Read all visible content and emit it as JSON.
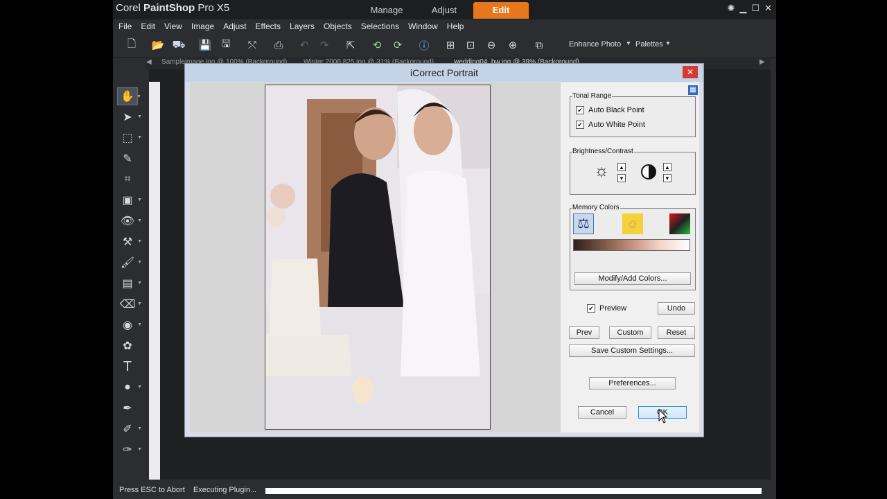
{
  "app": {
    "brand_light": "Corel ",
    "brand_bold": "PaintShop",
    "brand_suffix": " Pro X5",
    "tabs": [
      {
        "label": "Manage",
        "active": false
      },
      {
        "label": "Adjust",
        "active": false
      },
      {
        "label": "Edit",
        "active": true
      }
    ]
  },
  "menu": [
    "File",
    "Edit",
    "View",
    "Image",
    "Adjust",
    "Effects",
    "Layers",
    "Objects",
    "Selections",
    "Window",
    "Help"
  ],
  "toolbar": {
    "enhance_photo": "Enhance Photo",
    "palettes": "Palettes"
  },
  "doc_tabs": [
    "Sampleimage.jpg @ 100% (Background)",
    "Winter 2006 825.jpg @ 31% (Background)",
    "wedding04_bw.jpg @ 39% (Background)"
  ],
  "status": {
    "left": "Press ESC to Abort",
    "right": "Executing Plugin..."
  },
  "dialog": {
    "title": "iCorrect Portrait",
    "close_glyph": "✕",
    "tonal_range": {
      "label": "Tonal Range",
      "auto_black": "Auto Black Point",
      "auto_white": "Auto White Point"
    },
    "brightness_contrast": {
      "label": "Brightness/Contrast"
    },
    "memory_colors": {
      "label": "Memory Colors",
      "modify_button": "Modify/Add Colors..."
    },
    "preview_label": "Preview",
    "undo": "Undo",
    "prev": "Prev",
    "custom": "Custom",
    "reset": "Reset",
    "save_custom": "Save Custom Settings...",
    "preferences": "Preferences...",
    "cancel": "Cancel",
    "ok": "OK",
    "check_glyph": "✔",
    "spin_up": "▲",
    "spin_down": "▼"
  },
  "colors": {
    "accent": "#e8761c",
    "gradient_start": "#2e201a",
    "gradient_end": "#ffffff"
  }
}
